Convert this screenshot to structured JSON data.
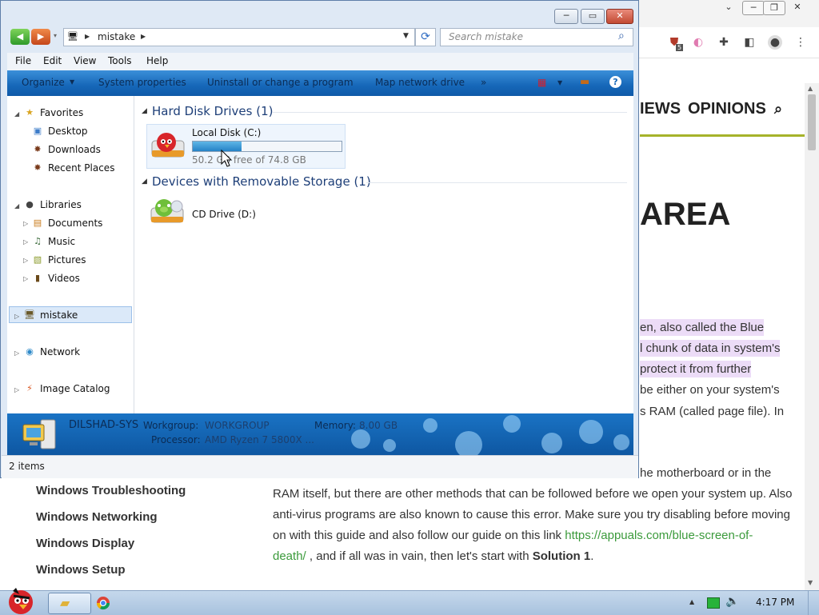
{
  "browser": {
    "nav": [
      "IEWS",
      "OPINIONS"
    ],
    "title_fragment": "AREA",
    "article_right": [
      "en, also called the Blue",
      "l chunk of data in system's",
      "protect it from further",
      "be either on your system's",
      "s RAM (called page file). In"
    ],
    "article_full": [
      "he motherboard or in the",
      "RAM itself, but there are other methods that can be followed before we open your system up. Also",
      "anti-virus programs are also known to cause this error. Make sure you try disabling before moving",
      "on with this guide and also follow our guide on this link "
    ],
    "article_link_1": "https://appuals.com/blue-screen-of-",
    "article_link_2": "death/",
    "article_tail": " , and if all was in vain, then let's start with ",
    "article_bold": "Solution 1",
    "article_end": ".",
    "sidebar_links": [
      "Windows Troubleshooting",
      "Windows Networking",
      "Windows Display",
      "Windows Setup"
    ],
    "extension_badge": "5"
  },
  "explorer": {
    "address": "mistake",
    "search_placeholder": "Search mistake",
    "menu": [
      "File",
      "Edit",
      "View",
      "Tools",
      "Help"
    ],
    "commands": [
      "Organize",
      "System properties",
      "Uninstall or change a program",
      "Map network drive",
      "»"
    ],
    "nav": {
      "favorites": "Favorites",
      "favorites_items": [
        "Desktop",
        "Downloads",
        "Recent Places"
      ],
      "libraries": "Libraries",
      "libraries_items": [
        "Documents",
        "Music",
        "Pictures",
        "Videos"
      ],
      "computer": "mistake",
      "network": "Network",
      "image_catalog": "Image Catalog"
    },
    "groups": {
      "hdd": "Hard Disk Drives (1)",
      "removable": "Devices with Removable Storage (1)"
    },
    "drive_c": {
      "name": "Local Disk (C:)",
      "free": "50.2 GB free of 74.8 GB",
      "used_fraction": 0.329
    },
    "drive_d": {
      "name": "CD Drive (D:)"
    },
    "details": {
      "computer": "DILSHAD-SYS",
      "workgroup_label": "Workgroup:",
      "workgroup": "WORKGROUP",
      "memory_label": "Memory:",
      "memory": "8.00 GB",
      "processor_label": "Processor:",
      "processor": "AMD Ryzen 7 5800X ..."
    },
    "status": "2 items"
  },
  "taskbar": {
    "time": "4:17 PM"
  },
  "colors": {
    "accent": "#1667b8",
    "site_accent": "#a6b32a",
    "link": "#3b9a3b",
    "highlight": "#ecdcf7"
  }
}
